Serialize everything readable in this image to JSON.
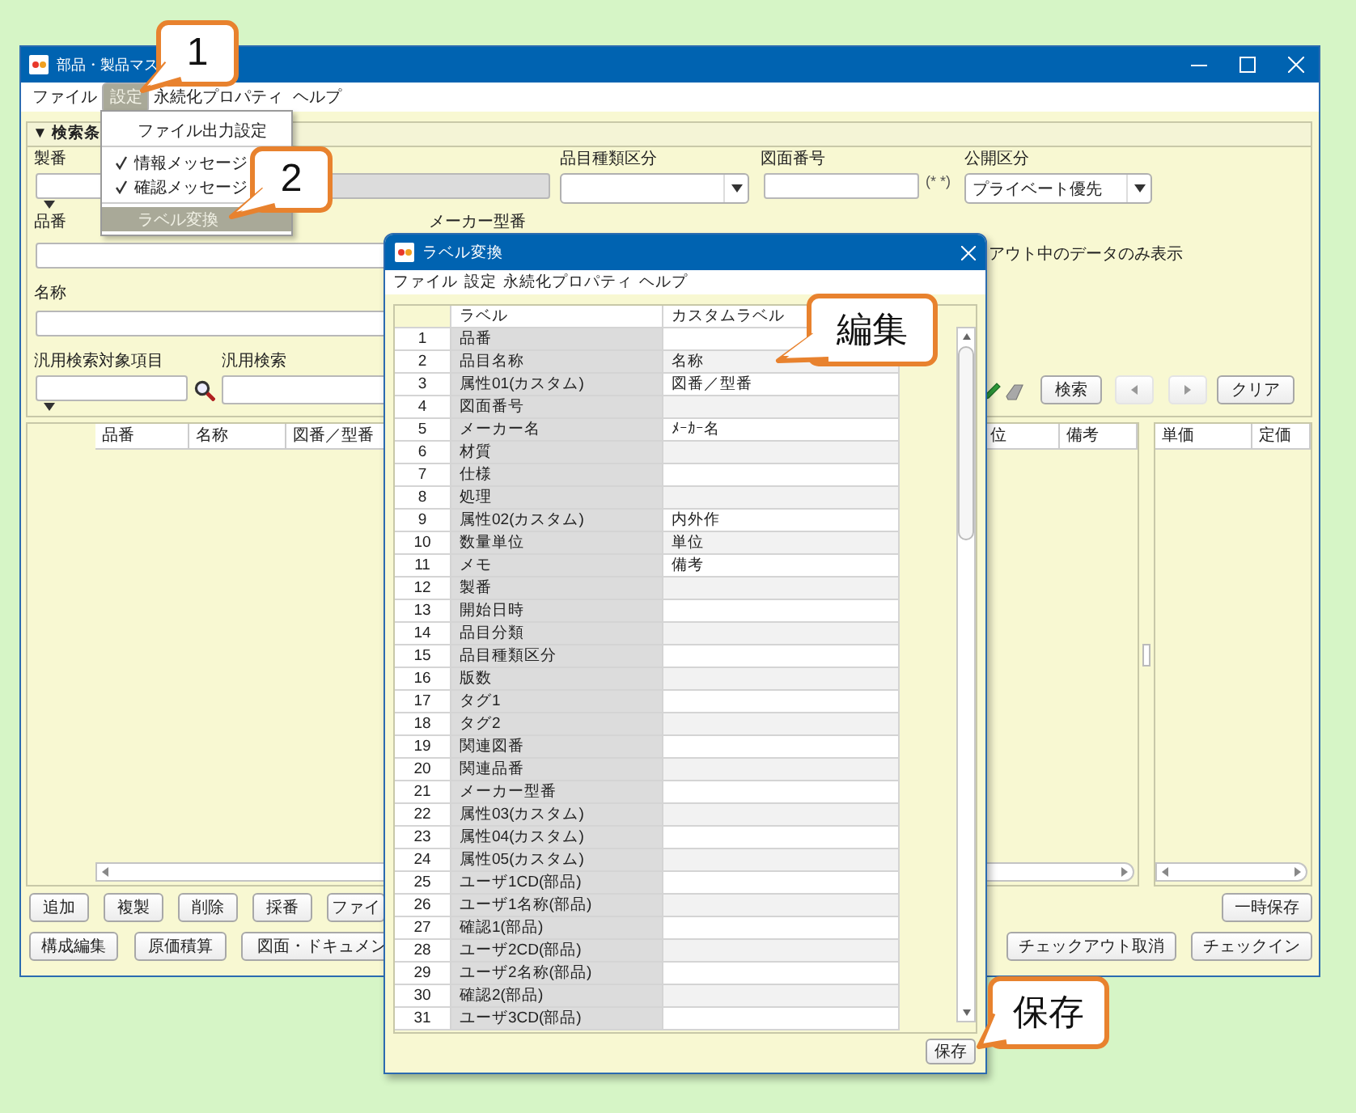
{
  "main_window": {
    "title": "部品・製品マス",
    "menu": [
      {
        "label": "ファイル",
        "selected": false
      },
      {
        "label": "設定",
        "selected": true
      },
      {
        "label": "永続化プロパティ",
        "selected": false
      },
      {
        "label": "ヘルプ",
        "selected": false
      }
    ],
    "search_panel": {
      "header": "▼ 検索条",
      "seiban_label": "製番",
      "item_type_label": "品目種類区分",
      "drawing_no_label": "図面番号",
      "drawing_no_hint": "(* *)",
      "visibility_label": "公開区分",
      "visibility_value": "プライベート優先",
      "part_no_label": "品番",
      "maker_model_label": "メーカー型番",
      "checkout_only_label": "アウト中のデータのみ表示",
      "name_label": "名称",
      "general_target_label": "汎用検索対象項目",
      "general_search_label": "汎用検索",
      "search_button": "検索",
      "clear_button": "クリア"
    },
    "results": {
      "left_columns": [
        "品番",
        "名称",
        "図番／型番"
      ],
      "middle_columns": [
        "位",
        "備考"
      ],
      "right_columns": [
        "単価",
        "定価"
      ]
    },
    "buttons_row_1": [
      "追加",
      "複製",
      "削除",
      "採番",
      "ファイ"
    ],
    "temp_save_button": "一時保存",
    "buttons_row_2": [
      "構成編集",
      "原価積算",
      "図面・ドキュメン"
    ],
    "checkout_buttons": [
      "チェックアウト取消",
      "チェックイン"
    ]
  },
  "settings_menu": {
    "items": [
      {
        "kind": "command",
        "label": "ファイル出力設定",
        "selected": false
      },
      {
        "kind": "separator"
      },
      {
        "kind": "check",
        "label": "情報メッセージ",
        "checked": true,
        "selected": false
      },
      {
        "kind": "check",
        "label": "確認メッセージ",
        "checked": true,
        "selected": false
      },
      {
        "kind": "separator"
      },
      {
        "kind": "command",
        "label": "ラベル変換",
        "selected": true
      }
    ]
  },
  "dialog": {
    "title": "ラベル変換",
    "menu": [
      "ファイル",
      "設定",
      "永続化プロパティ",
      "ヘルプ"
    ],
    "columns": [
      "ラベル",
      "カスタムラベル"
    ],
    "rows": [
      {
        "no": "1",
        "label": "品番"
      },
      {
        "no": "2",
        "label": "品目名称",
        "custom": "名称"
      },
      {
        "no": "3",
        "label": "属性01(カスタム)",
        "custom": "図番／型番"
      },
      {
        "no": "4",
        "label": "図面番号"
      },
      {
        "no": "5",
        "label": "メーカー名",
        "custom": "ﾒｰｶｰ名"
      },
      {
        "no": "6",
        "label": "材質"
      },
      {
        "no": "7",
        "label": "仕様"
      },
      {
        "no": "8",
        "label": "処理"
      },
      {
        "no": "9",
        "label": "属性02(カスタム)",
        "custom": "内外作"
      },
      {
        "no": "10",
        "label": "数量単位",
        "custom": "単位"
      },
      {
        "no": "11",
        "label": "メモ",
        "custom": "備考"
      },
      {
        "no": "12",
        "label": "製番"
      },
      {
        "no": "13",
        "label": "開始日時"
      },
      {
        "no": "14",
        "label": "品目分類"
      },
      {
        "no": "15",
        "label": "品目種類区分"
      },
      {
        "no": "16",
        "label": "版数"
      },
      {
        "no": "17",
        "label": "タグ1"
      },
      {
        "no": "18",
        "label": "タグ2"
      },
      {
        "no": "19",
        "label": "関連図番"
      },
      {
        "no": "20",
        "label": "関連品番"
      },
      {
        "no": "21",
        "label": "メーカー型番"
      },
      {
        "no": "22",
        "label": "属性03(カスタム)"
      },
      {
        "no": "23",
        "label": "属性04(カスタム)"
      },
      {
        "no": "24",
        "label": "属性05(カスタム)"
      },
      {
        "no": "25",
        "label": "ユーザ1CD(部品)"
      },
      {
        "no": "26",
        "label": "ユーザ1名称(部品)"
      },
      {
        "no": "27",
        "label": "確認1(部品)"
      },
      {
        "no": "28",
        "label": "ユーザ2CD(部品)"
      },
      {
        "no": "29",
        "label": "ユーザ2名称(部品)"
      },
      {
        "no": "30",
        "label": "確認2(部品)"
      },
      {
        "no": "31",
        "label": "ユーザ3CD(部品)"
      }
    ],
    "save_button": "保存"
  },
  "callouts": [
    {
      "text": "1"
    },
    {
      "text": "2"
    },
    {
      "text": "編集"
    },
    {
      "text": "保存"
    }
  ]
}
